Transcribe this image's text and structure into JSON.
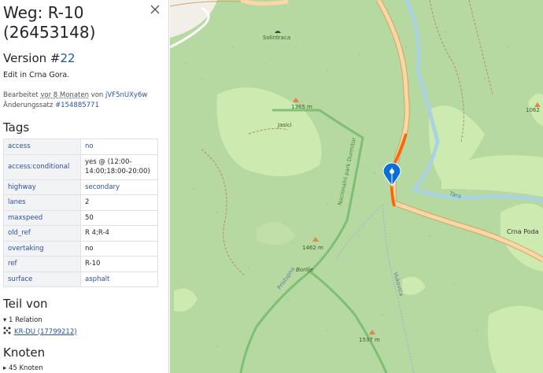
{
  "sidebar": {
    "title": "Weg: R-10 (26453148)",
    "version_prefix": "Version #",
    "version_number": "22",
    "comment": "Edit in Crna Gora.",
    "edited_prefix": "Bearbeitet ",
    "edited_time": "vor 8 Monaten",
    "edited_by": " von ",
    "user": "jVF5nUXy6w",
    "changeset_label": "Änderungssatz ",
    "changeset": "#154885771",
    "tags_heading": "Tags",
    "tags": [
      {
        "key": "access",
        "value": "no",
        "link": true
      },
      {
        "key": "access:conditional",
        "value": "yes @ (12:00-14:00;18:00-20:00)",
        "link": false
      },
      {
        "key": "highway",
        "value": "secondary",
        "link": true
      },
      {
        "key": "lanes",
        "value": "2",
        "link": false
      },
      {
        "key": "maxspeed",
        "value": "50",
        "link": false
      },
      {
        "key": "old_ref",
        "value": "R 4;R-4",
        "link": false
      },
      {
        "key": "overtaking",
        "value": "no",
        "link": false
      },
      {
        "key": "ref",
        "value": "R-10",
        "link": false
      },
      {
        "key": "surface",
        "value": "asphalt",
        "link": true
      }
    ],
    "part_of_heading": "Teil von",
    "relation_count": "▾ 1 Relation",
    "relation_name": "KR-DU (17799212)",
    "nodes_heading": "Knoten",
    "nodes_count": "▸ 45 Knoten"
  },
  "map": {
    "labels": {
      "solintraca": "Solintraca",
      "jasici": "Jasici",
      "peak1": "1365 m",
      "peak2": "1462 m",
      "peak3": "1537 m",
      "peak4": "1062",
      "borilje": "Borilje",
      "tara": "Tara",
      "crna_poda": "Crna Poda",
      "park_road": "Nacionalni park Durmitor",
      "track": "Vukovića",
      "path2": "Pristupna"
    },
    "colors": {
      "forest": "#add19e",
      "grass": "#cdebb0",
      "river": "#aad3df",
      "road_primary": "#fcd6a4",
      "highlight": "#ff6200",
      "marker": "#0b6dd8"
    }
  }
}
